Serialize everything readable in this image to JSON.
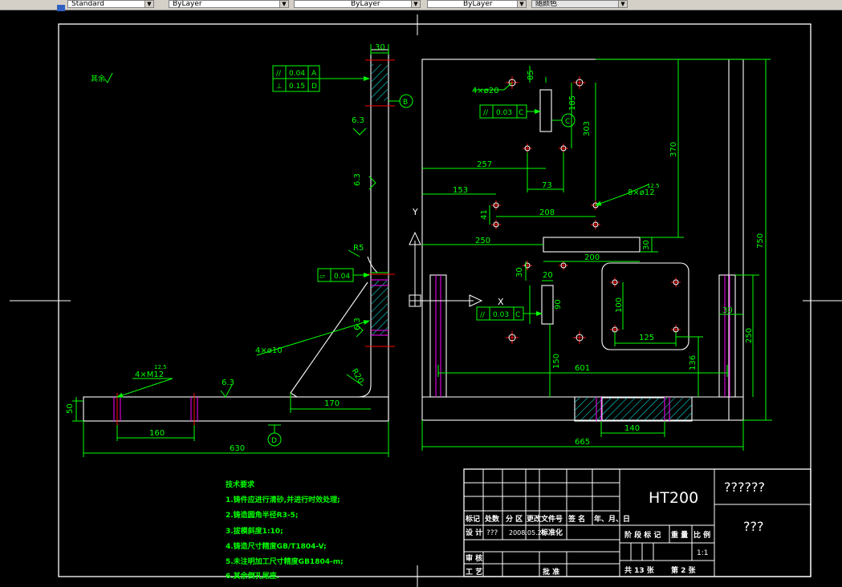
{
  "toolbar": {
    "text_style": "Standard",
    "layer": "ByLayer",
    "linetype": "ByLayer",
    "lineweight": "ByLayer",
    "plot_style": "随颜色"
  },
  "drawing": {
    "left_view": {
      "roughness_other": "其余",
      "fcf_parallel": {
        "symbol": "//",
        "value": "0.04",
        "datum": "A"
      },
      "fcf_perp": {
        "symbol": "⊥",
        "value": "0.15",
        "datum": "D"
      },
      "datum_b": "B",
      "datum_d": "D",
      "dim_top_width": "30",
      "rough_1": "6.3",
      "rough_2": "6.3",
      "rough_3": "6.3",
      "rough_4": "6.3",
      "rough_5": "12.5",
      "radius_r5": "R5",
      "radius_r20": "R20",
      "fcf_flat": {
        "value": "0.04"
      },
      "holes_m12": "4×M12",
      "holes_d10": "4×ø10",
      "dim_50": "50",
      "dim_160": "160",
      "dim_170": "170",
      "dim_630": "630"
    },
    "right_view": {
      "holes_d20": "4×ø20",
      "dim_85": "85",
      "fcf_c1": {
        "symbol": "//",
        "value": "0.03",
        "datum": "C"
      },
      "datum_c": "C",
      "dim_185": "185",
      "dim_303": "303",
      "dim_370": "370",
      "dim_257": "257",
      "dim_73": "73",
      "holes_d12": "8×ø12",
      "rough_12_5": "12.5",
      "dim_153": "153",
      "dim_41": "41",
      "dim_208": "208",
      "axis_y": "Y",
      "axis_x": "X",
      "dim_250_top": "250",
      "dim_30_top": "30",
      "dim_200": "200",
      "dim_30_mid": "30",
      "dim_20": "20",
      "fcf_c2": {
        "symbol": "//",
        "value": "0.03",
        "datum": "C"
      },
      "dim_90": "90",
      "dim_100": "100",
      "dim_125": "125",
      "dim_30_right": "30",
      "dim_250_right": "250",
      "dim_750": "750",
      "dim_150": "150",
      "dim_601": "601",
      "dim_136": "136",
      "dim_140": "140",
      "dim_665": "665"
    },
    "tech_req": {
      "title": "技术要求",
      "lines": [
        "1.铸件应进行清砂,并进行时效处理;",
        "2.铸造圆角半径R3-5;",
        "3.拔模斜度1:10;",
        "4.铸造尺寸精度GB/T1804-V;",
        "5.未注明加工尺寸精度GB1804-m;",
        "6.其余倒孔尾座."
      ]
    },
    "title_block": {
      "material": "HT200",
      "name": "??????",
      "code": "???",
      "h_mark": "标记",
      "h_count": "处数",
      "h_zone": "分 区",
      "h_docno": "更改文件号",
      "h_sign": "签 名",
      "h_date": "年、月、日",
      "designer_label": "设 计",
      "designer": "???",
      "date": "2008.05.28",
      "standardize": "标准化",
      "stage_label": "阶 段 标 记",
      "weight_label": "重 量",
      "scale_label": "比 例",
      "scale": "1:1",
      "review": "审 核",
      "process": "工 艺",
      "approve": "批 准",
      "sheets": "共 13 张",
      "sheet_no": "第 2 张"
    }
  },
  "colors": {
    "background": "#000000",
    "outline": "#ffffff",
    "dimension": "#00ff00",
    "centerline": "#ff0000",
    "hatch": "#00ffff",
    "hole_bore": "#ff00ff"
  }
}
